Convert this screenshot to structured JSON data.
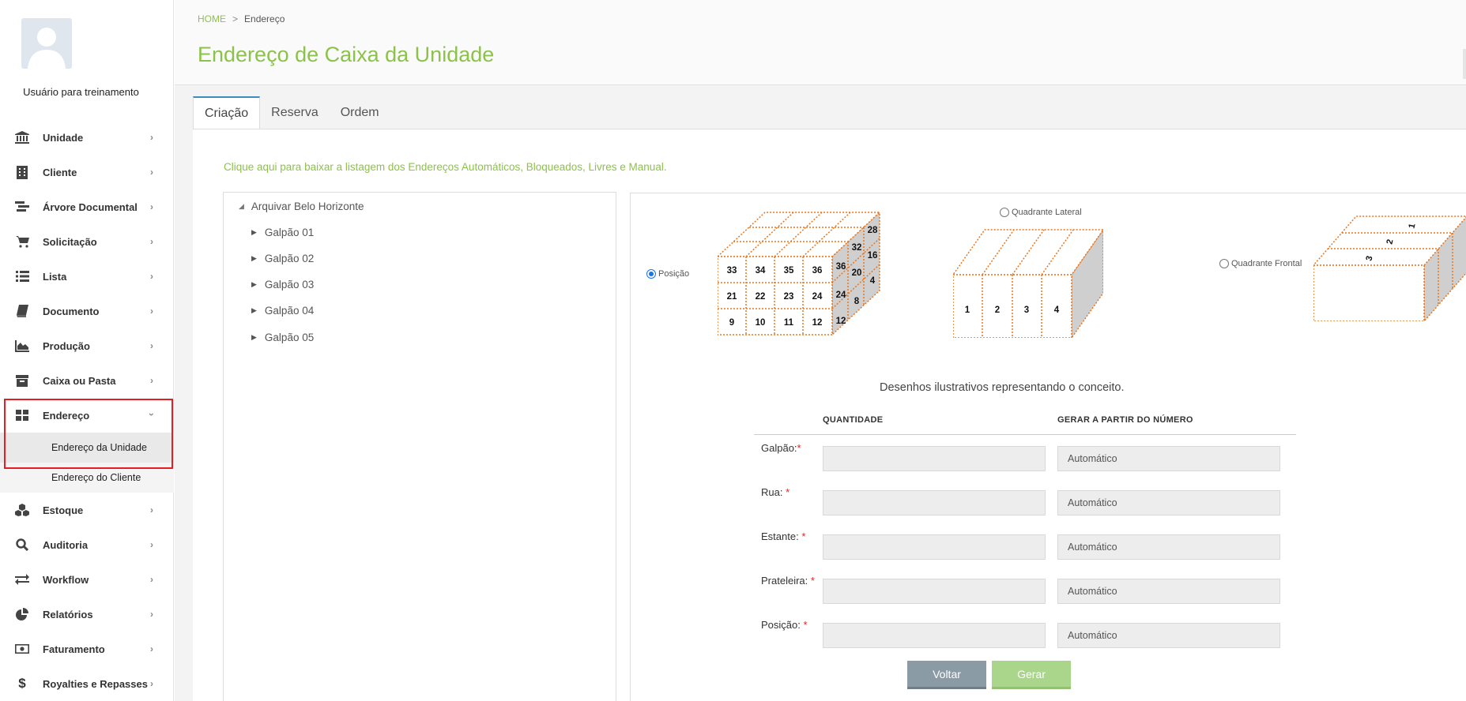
{
  "user": {
    "name": "Usuário para treinamento"
  },
  "sidebar": {
    "items": [
      {
        "label": "Unidade",
        "icon": "bank-icon"
      },
      {
        "label": "Cliente",
        "icon": "building-icon"
      },
      {
        "label": "Árvore Documental",
        "icon": "tree-icon"
      },
      {
        "label": "Solicitação",
        "icon": "cart-icon"
      },
      {
        "label": "Lista",
        "icon": "list-icon"
      },
      {
        "label": "Documento",
        "icon": "book-icon"
      },
      {
        "label": "Produção",
        "icon": "area-chart-icon"
      },
      {
        "label": "Caixa ou Pasta",
        "icon": "archive-icon"
      },
      {
        "label": "Endereço",
        "icon": "grid-icon",
        "expanded": true
      }
    ],
    "subitems": [
      {
        "label": "Endereço da Unidade",
        "active": true
      },
      {
        "label": "Endereço do Cliente",
        "active": false
      }
    ],
    "items_after": [
      {
        "label": "Estoque",
        "icon": "cubes-icon"
      },
      {
        "label": "Auditoria",
        "icon": "search-icon"
      },
      {
        "label": "Workflow",
        "icon": "exchange-icon"
      },
      {
        "label": "Relatórios",
        "icon": "pie-chart-icon"
      },
      {
        "label": "Faturamento",
        "icon": "money-icon"
      },
      {
        "label": "Royalties e Repasses",
        "icon": "dollar-icon"
      }
    ]
  },
  "breadcrumb": {
    "home": "HOME",
    "current": "Endereço"
  },
  "page": {
    "title": "Endereço de Caixa da Unidade"
  },
  "tabs": [
    "Criação",
    "Reserva",
    "Ordem"
  ],
  "download_link": "Clique aqui para baixar a listagem dos Endereços Automáticos, Bloqueados, Livres e Manual.",
  "tree": {
    "root": "Arquivar Belo Horizonte",
    "children": [
      "Galpão 01",
      "Galpão 02",
      "Galpão 03",
      "Galpão 04",
      "Galpão 05"
    ]
  },
  "diagrams": {
    "posicao": {
      "label": "Posição",
      "selected": true,
      "front_rows": [
        [
          "33",
          "34",
          "35",
          "36"
        ],
        [
          "21",
          "22",
          "23",
          "24"
        ],
        [
          "9",
          "10",
          "11",
          "12"
        ]
      ],
      "side_rows": [
        [
          "28"
        ],
        [
          "32",
          "16"
        ],
        [
          "36",
          "20",
          "4"
        ],
        [
          "24",
          "8"
        ],
        [
          "12"
        ]
      ]
    },
    "lateral": {
      "label": "Quadrante Lateral",
      "selected": false,
      "slots": [
        "1",
        "2",
        "3",
        "4"
      ]
    },
    "frontal": {
      "label": "Quadrante Frontal",
      "selected": false,
      "slots": [
        "1",
        "2",
        "3"
      ]
    }
  },
  "caption": "Desenhos ilustrativos representando o conceito.",
  "form": {
    "col_quantity": "QUANTIDADE",
    "col_from": "GERAR A PARTIR DO NÚMERO",
    "rows": [
      {
        "label": "Galpão:",
        "quantity": "",
        "from_placeholder": "Automático"
      },
      {
        "label": "Rua: ",
        "quantity": "",
        "from_placeholder": "Automático"
      },
      {
        "label": "Estante: ",
        "quantity": "",
        "from_placeholder": "Automático"
      },
      {
        "label": "Prateleira: ",
        "quantity": "",
        "from_placeholder": "Automático"
      },
      {
        "label": "Posição: ",
        "quantity": "",
        "from_placeholder": "Automático"
      }
    ],
    "required_mark": "*"
  },
  "buttons": {
    "back": "Voltar",
    "generate": "Gerar"
  },
  "colors": {
    "accent_green": "#8dc24a",
    "highlight_red": "#e31e24",
    "diagram_orange": "#e8761e"
  }
}
